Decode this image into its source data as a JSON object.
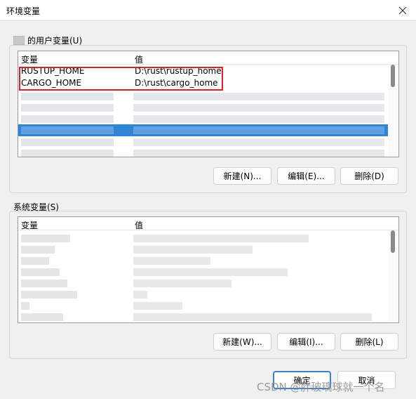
{
  "window": {
    "title": "环境变量",
    "close_icon": "close-icon"
  },
  "user_vars": {
    "label": "的用户变量(U)",
    "columns": {
      "name": "变量",
      "value": "值"
    },
    "rows": [
      {
        "name": "RUSTUP_HOME",
        "value": "D:\\rust\\rustup_home"
      },
      {
        "name": "CARGO_HOME",
        "value": "D:\\rust\\cargo_home"
      }
    ],
    "buttons": {
      "new": "新建(N)...",
      "edit": "编辑(E)...",
      "delete": "删除(D)"
    }
  },
  "system_vars": {
    "label": "系统变量(S)",
    "columns": {
      "name": "变量",
      "value": "值"
    },
    "buttons": {
      "new": "新建(W)...",
      "edit": "编辑(I)...",
      "delete": "删除(L)"
    }
  },
  "footer": {
    "ok": "确定",
    "cancel": "取消"
  },
  "watermark": "CSDN @胖玻璃球就一个名",
  "colors": {
    "selection": "#2f84d6",
    "highlight_border": "#e02020",
    "default_button_border": "#3a82d0"
  }
}
